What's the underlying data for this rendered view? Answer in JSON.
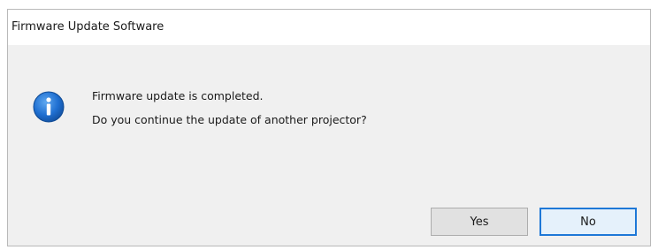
{
  "dialog": {
    "title": "Firmware Update Software",
    "icon": "info-icon",
    "message_lines": [
      "Firmware update is completed.",
      "Do you continue the update of another projector?"
    ],
    "buttons": {
      "yes_label": "Yes",
      "no_label": "No"
    },
    "colors": {
      "icon_blue": "#1f6fd1",
      "default_button_border": "#1e78d7"
    }
  }
}
